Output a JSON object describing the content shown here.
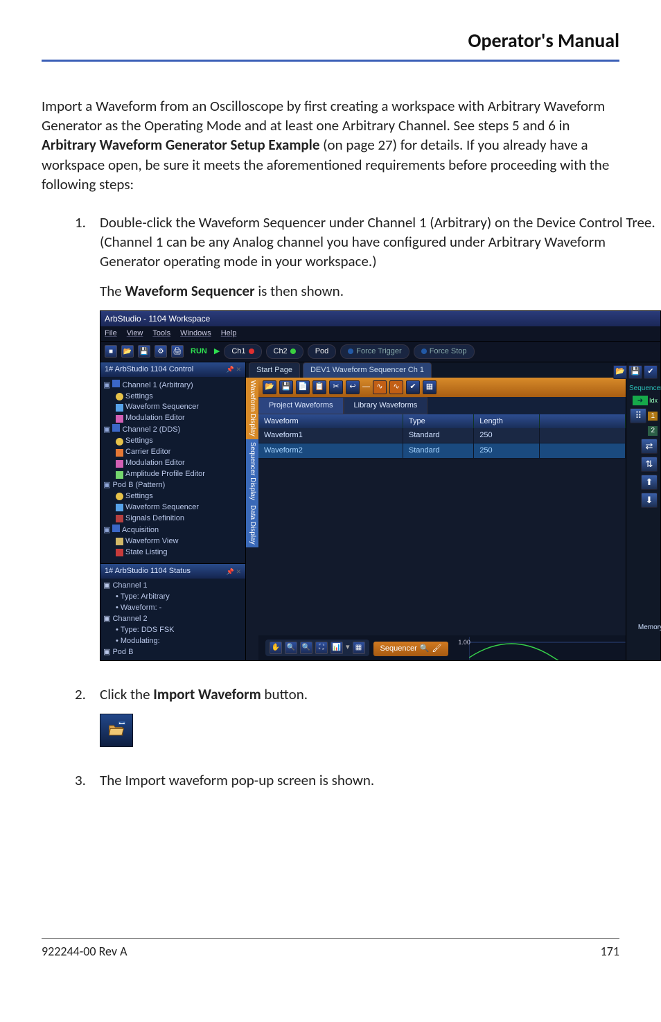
{
  "header": {
    "title": "Operator's Manual"
  },
  "intro": {
    "p1a": "Import a Waveform from an Oscilloscope by first creating a workspace with Arbitrary Waveform Generator as the Operating Mode and at least one Arbitrary Channel. See steps 5 and 6 in ",
    "p1b": "Arbitrary Waveform Generator Setup Example",
    "p1c": " (on page 27) for details. If you already have a workspace open, be sure it meets the aforementioned requirements before proceeding with the following steps:"
  },
  "steps": {
    "s1": {
      "num": "1.",
      "p1": "Double-click the Waveform Sequencer under Channel 1 (Arbitrary) on the Device Control Tree. (Channel 1 can be any Analog channel you have configured under Arbitrary Waveform Generator operating mode in your workspace.)",
      "p2a": "The ",
      "p2b": "Waveform Sequencer",
      "p2c": " is then shown."
    },
    "s2": {
      "num": "2.",
      "p1a": "Click the ",
      "p1b": "Import Waveform",
      "p1c": " button."
    },
    "s3": {
      "num": "3.",
      "p1": "The Import waveform pop-up screen is shown."
    }
  },
  "screenshot": {
    "title": "ArbStudio - 1104 Workspace",
    "menus": {
      "file": "File",
      "view": "View",
      "tools": "Tools",
      "windows": "Windows",
      "help": "Help"
    },
    "toolbar": {
      "run": "RUN",
      "ch1": "Ch1",
      "ch2": "Ch2",
      "pod": "Pod",
      "force_trigger": "Force Trigger",
      "force_stop": "Force Stop"
    },
    "left_panel": {
      "title": "1# ArbStudio 1104 Control",
      "pin": "📌 ✕",
      "tree": {
        "ch1": "Channel 1 (Arbitrary)",
        "settings": "Settings",
        "wseq": "Waveform Sequencer",
        "moded": "Modulation Editor",
        "ch2": "Channel 2 (DDS)",
        "settings2": "Settings",
        "carrier": "Carrier Editor",
        "moded2": "Modulation Editor",
        "amp": "Amplitude Profile Editor",
        "podb": "Pod B (Pattern)",
        "settings3": "Settings",
        "wseq2": "Waveform Sequencer",
        "sigdef": "Signals Definition",
        "acq": "Acquisition",
        "wview": "Waveform View",
        "statel": "State Listing"
      }
    },
    "tabs": {
      "start": "Start Page",
      "dev1": "DEV1 Waveform Sequencer Ch 1"
    },
    "sub_tabs": {
      "proj": "Project Waveforms",
      "lib": "Library Waveforms"
    },
    "vert_tabs": {
      "wdisp": "Waveform Display",
      "sdisp": "Sequencer Display",
      "ddisp": "Data Display"
    },
    "grid": {
      "cols": {
        "c1": "Waveform",
        "c2": "Type",
        "c3": "Length",
        "c4": ""
      },
      "rows": [
        {
          "w": "Waveform1",
          "t": "Standard",
          "l": "250"
        },
        {
          "w": "Waveform2",
          "t": "Standard",
          "l": "250"
        }
      ]
    },
    "right": {
      "sequencer_label": "Sequencer",
      "idx": "Idx",
      "idx1": "1",
      "idx2": "2",
      "memory": "Memory"
    },
    "status_panel": {
      "title": "1# ArbStudio 1104 Status",
      "pin": "📌 ✕",
      "tree": {
        "ch1": "Channel 1",
        "type1": "Type: Arbitrary",
        "wave1": "Waveform: -",
        "ch2": "Channel 2",
        "type2": "Type: DDS FSK",
        "mod": "Modulating:",
        "podb": "Pod B"
      }
    },
    "bottom": {
      "sequencer_btn": "Sequencer",
      "ylabel": "1.00"
    }
  },
  "footer": {
    "left": "922244-00 Rev A",
    "right": "171"
  }
}
